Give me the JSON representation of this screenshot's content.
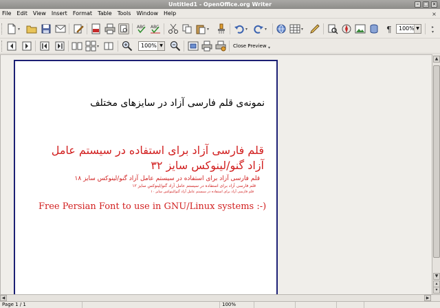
{
  "window": {
    "title": "Untitled1 - OpenOffice.org Writer"
  },
  "menu": {
    "items": [
      {
        "label": "File"
      },
      {
        "label": "Edit"
      },
      {
        "label": "View"
      },
      {
        "label": "Insert"
      },
      {
        "label": "Format"
      },
      {
        "label": "Table"
      },
      {
        "label": "Tools"
      },
      {
        "label": "Window"
      },
      {
        "label": "Help"
      }
    ]
  },
  "toolbar": {
    "zoom_value": "100%",
    "preview_zoom_value": "100%",
    "close_preview_label": "Close Preview"
  },
  "document": {
    "heading": "نمونه‌ی قلم فارسی آزاد در سایزهای مختلف",
    "red_line1": "قلم فارسی آزاد برای استفاده در سیستم عامل",
    "red_line2": "آزاد گنو/لینوکس  سایز ۳۲",
    "red_size18": "قلم فارسی آزاد برای استفاده در سیستم عامل آزاد گنو/لینوکس  سایز ۱۸",
    "red_size12": "قلم فارسی آزاد برای استفاده در سیستم عامل آزاد گنو/لینوکس  سایز ۱۲",
    "red_size10": "قلم فارسی آزاد برای استفاده در سیستم عامل آزاد گنو/لینوکس  سایز ۱۰",
    "latin_line": "Free Persian Font to use in GNU/Linux systems :-)"
  },
  "status": {
    "page": "Page 1 / 1",
    "zoom": "100%"
  },
  "colors": {
    "accent_red": "#d11e1e",
    "page_border": "#1b1f74"
  }
}
